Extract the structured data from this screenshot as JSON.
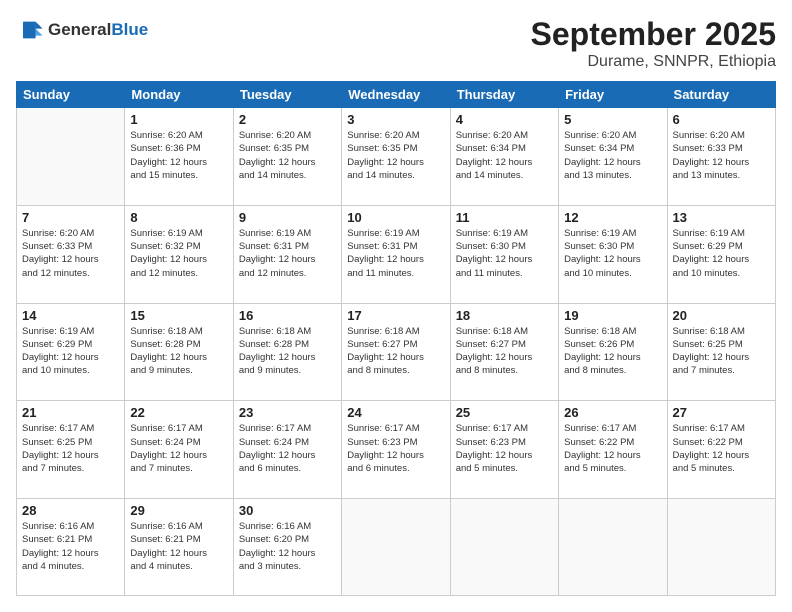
{
  "header": {
    "logo_line1": "General",
    "logo_line2": "Blue",
    "month_title": "September 2025",
    "location": "Durame, SNNPR, Ethiopia"
  },
  "weekdays": [
    "Sunday",
    "Monday",
    "Tuesday",
    "Wednesday",
    "Thursday",
    "Friday",
    "Saturday"
  ],
  "weeks": [
    [
      {
        "day": "",
        "info": ""
      },
      {
        "day": "1",
        "info": "Sunrise: 6:20 AM\nSunset: 6:36 PM\nDaylight: 12 hours\nand 15 minutes."
      },
      {
        "day": "2",
        "info": "Sunrise: 6:20 AM\nSunset: 6:35 PM\nDaylight: 12 hours\nand 14 minutes."
      },
      {
        "day": "3",
        "info": "Sunrise: 6:20 AM\nSunset: 6:35 PM\nDaylight: 12 hours\nand 14 minutes."
      },
      {
        "day": "4",
        "info": "Sunrise: 6:20 AM\nSunset: 6:34 PM\nDaylight: 12 hours\nand 14 minutes."
      },
      {
        "day": "5",
        "info": "Sunrise: 6:20 AM\nSunset: 6:34 PM\nDaylight: 12 hours\nand 13 minutes."
      },
      {
        "day": "6",
        "info": "Sunrise: 6:20 AM\nSunset: 6:33 PM\nDaylight: 12 hours\nand 13 minutes."
      }
    ],
    [
      {
        "day": "7",
        "info": "Sunrise: 6:20 AM\nSunset: 6:33 PM\nDaylight: 12 hours\nand 12 minutes."
      },
      {
        "day": "8",
        "info": "Sunrise: 6:19 AM\nSunset: 6:32 PM\nDaylight: 12 hours\nand 12 minutes."
      },
      {
        "day": "9",
        "info": "Sunrise: 6:19 AM\nSunset: 6:31 PM\nDaylight: 12 hours\nand 12 minutes."
      },
      {
        "day": "10",
        "info": "Sunrise: 6:19 AM\nSunset: 6:31 PM\nDaylight: 12 hours\nand 11 minutes."
      },
      {
        "day": "11",
        "info": "Sunrise: 6:19 AM\nSunset: 6:30 PM\nDaylight: 12 hours\nand 11 minutes."
      },
      {
        "day": "12",
        "info": "Sunrise: 6:19 AM\nSunset: 6:30 PM\nDaylight: 12 hours\nand 10 minutes."
      },
      {
        "day": "13",
        "info": "Sunrise: 6:19 AM\nSunset: 6:29 PM\nDaylight: 12 hours\nand 10 minutes."
      }
    ],
    [
      {
        "day": "14",
        "info": "Sunrise: 6:19 AM\nSunset: 6:29 PM\nDaylight: 12 hours\nand 10 minutes."
      },
      {
        "day": "15",
        "info": "Sunrise: 6:18 AM\nSunset: 6:28 PM\nDaylight: 12 hours\nand 9 minutes."
      },
      {
        "day": "16",
        "info": "Sunrise: 6:18 AM\nSunset: 6:28 PM\nDaylight: 12 hours\nand 9 minutes."
      },
      {
        "day": "17",
        "info": "Sunrise: 6:18 AM\nSunset: 6:27 PM\nDaylight: 12 hours\nand 8 minutes."
      },
      {
        "day": "18",
        "info": "Sunrise: 6:18 AM\nSunset: 6:27 PM\nDaylight: 12 hours\nand 8 minutes."
      },
      {
        "day": "19",
        "info": "Sunrise: 6:18 AM\nSunset: 6:26 PM\nDaylight: 12 hours\nand 8 minutes."
      },
      {
        "day": "20",
        "info": "Sunrise: 6:18 AM\nSunset: 6:25 PM\nDaylight: 12 hours\nand 7 minutes."
      }
    ],
    [
      {
        "day": "21",
        "info": "Sunrise: 6:17 AM\nSunset: 6:25 PM\nDaylight: 12 hours\nand 7 minutes."
      },
      {
        "day": "22",
        "info": "Sunrise: 6:17 AM\nSunset: 6:24 PM\nDaylight: 12 hours\nand 7 minutes."
      },
      {
        "day": "23",
        "info": "Sunrise: 6:17 AM\nSunset: 6:24 PM\nDaylight: 12 hours\nand 6 minutes."
      },
      {
        "day": "24",
        "info": "Sunrise: 6:17 AM\nSunset: 6:23 PM\nDaylight: 12 hours\nand 6 minutes."
      },
      {
        "day": "25",
        "info": "Sunrise: 6:17 AM\nSunset: 6:23 PM\nDaylight: 12 hours\nand 5 minutes."
      },
      {
        "day": "26",
        "info": "Sunrise: 6:17 AM\nSunset: 6:22 PM\nDaylight: 12 hours\nand 5 minutes."
      },
      {
        "day": "27",
        "info": "Sunrise: 6:17 AM\nSunset: 6:22 PM\nDaylight: 12 hours\nand 5 minutes."
      }
    ],
    [
      {
        "day": "28",
        "info": "Sunrise: 6:16 AM\nSunset: 6:21 PM\nDaylight: 12 hours\nand 4 minutes."
      },
      {
        "day": "29",
        "info": "Sunrise: 6:16 AM\nSunset: 6:21 PM\nDaylight: 12 hours\nand 4 minutes."
      },
      {
        "day": "30",
        "info": "Sunrise: 6:16 AM\nSunset: 6:20 PM\nDaylight: 12 hours\nand 3 minutes."
      },
      {
        "day": "",
        "info": ""
      },
      {
        "day": "",
        "info": ""
      },
      {
        "day": "",
        "info": ""
      },
      {
        "day": "",
        "info": ""
      }
    ]
  ]
}
